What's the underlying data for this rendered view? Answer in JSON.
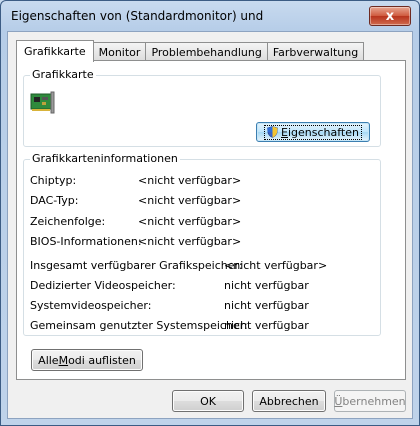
{
  "window": {
    "title": "Eigenschaften von (Standardmonitor) und",
    "close_label": "x"
  },
  "tabs": [
    {
      "label": "Grafikkarte"
    },
    {
      "label": "Monitor"
    },
    {
      "label": "Problembehandlung"
    },
    {
      "label": "Farbverwaltung"
    }
  ],
  "grafikkarte_group": {
    "title": "Grafikkarte",
    "icon": "graphics-card-icon",
    "properties_button_prefix": "E",
    "properties_button_rest": "igenschaften"
  },
  "info_group": {
    "title": "Grafikkarteninformationen",
    "rows": [
      {
        "label": "Chiptyp:",
        "value": "<nicht verfügbar>"
      },
      {
        "label": "DAC-Typ:",
        "value": "<nicht verfügbar>"
      },
      {
        "label": "Zeichenfolge:",
        "value": "<nicht verfügbar>"
      },
      {
        "label": "BIOS-Informationen:",
        "value": "<nicht verfügbar>"
      }
    ],
    "memory_rows": [
      {
        "label": "Insgesamt verfügbarer Grafikspeicher:",
        "value": "<nicht verfügbar>"
      },
      {
        "label": "Dedizierter Videospeicher:",
        "value": "nicht verfügbar"
      },
      {
        "label": "Systemvideospeicher:",
        "value": "nicht verfügbar"
      },
      {
        "label": "Gemeinsam genutzter Systemspeicher:",
        "value": "nicht verfügbar"
      }
    ]
  },
  "list_modes_button": {
    "prefix": "Alle ",
    "underlined": "M",
    "rest": "odi auflisten"
  },
  "footer": {
    "ok_label": "OK",
    "cancel_label": "Abbrechen",
    "apply_underlined": "Ü",
    "apply_rest": "bernehmen"
  },
  "colors": {
    "accent": "#3c7fb1",
    "titlebar": "#c8daef",
    "close": "#cf5a3e"
  }
}
